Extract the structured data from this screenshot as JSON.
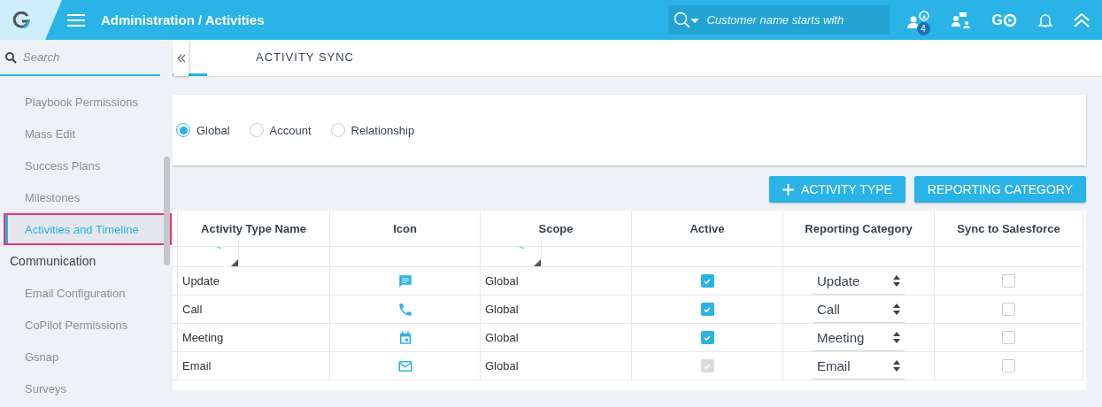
{
  "header": {
    "breadcrumb": "Administration / Activities",
    "search": {
      "placeholder": "Customer name starts with"
    },
    "badge": "4",
    "go_label": "G"
  },
  "sidebar": {
    "search": {
      "placeholder": "Search"
    },
    "items": [
      {
        "kind": "item",
        "label": "Playbook Permissions",
        "selected": false
      },
      {
        "kind": "item",
        "label": "Mass Edit",
        "selected": false
      },
      {
        "kind": "item",
        "label": "Success Plans",
        "selected": false
      },
      {
        "kind": "item",
        "label": "Milestones",
        "selected": false
      },
      {
        "kind": "item",
        "label": "Activities and Timeline",
        "selected": true
      },
      {
        "kind": "group",
        "label": "Communication",
        "children": [
          {
            "kind": "item",
            "label": "Email Configuration",
            "selected": false
          },
          {
            "kind": "item",
            "label": "CoPilot Permissions",
            "selected": false
          },
          {
            "kind": "item",
            "label": "Gsnap",
            "selected": false
          },
          {
            "kind": "item",
            "label": "Surveys",
            "selected": false
          }
        ]
      }
    ]
  },
  "tabs": [
    {
      "label": "ACTIVITY SYNC",
      "selected": false
    }
  ],
  "scope_options": [
    {
      "label": "Global",
      "selected": true
    },
    {
      "label": "Account",
      "selected": false
    },
    {
      "label": "Relationship",
      "selected": false
    }
  ],
  "buttons": [
    {
      "kind": "add",
      "label": "ACTIVITY TYPE"
    },
    {
      "kind": "plain",
      "label": "REPORTING CATEGORY"
    }
  ],
  "table": {
    "columns": [
      "Activity Type Name",
      "Icon",
      "Scope",
      "Active",
      "Reporting Category",
      "Sync to Salesforce"
    ],
    "filters": [
      {
        "kind": "filter",
        "label": "~"
      },
      {
        "kind": "empty"
      },
      {
        "kind": "filter",
        "label": "~"
      },
      {
        "kind": "empty"
      },
      {
        "kind": "empty"
      },
      {
        "kind": "empty"
      }
    ],
    "rows": [
      {
        "name": "Update",
        "kind": "chat",
        "scope": "Global",
        "active": true,
        "active_disabled": false,
        "category": "Update",
        "sync": false
      },
      {
        "name": "Call",
        "kind": "phone",
        "scope": "Global",
        "active": true,
        "active_disabled": false,
        "category": "Call",
        "sync": false
      },
      {
        "name": "Meeting",
        "kind": "calendar",
        "scope": "Global",
        "active": true,
        "active_disabled": false,
        "category": "Meeting",
        "sync": false
      },
      {
        "name": "Email",
        "kind": "mail",
        "scope": "Global",
        "active": true,
        "active_disabled": true,
        "category": "Email",
        "sync": false
      }
    ]
  }
}
